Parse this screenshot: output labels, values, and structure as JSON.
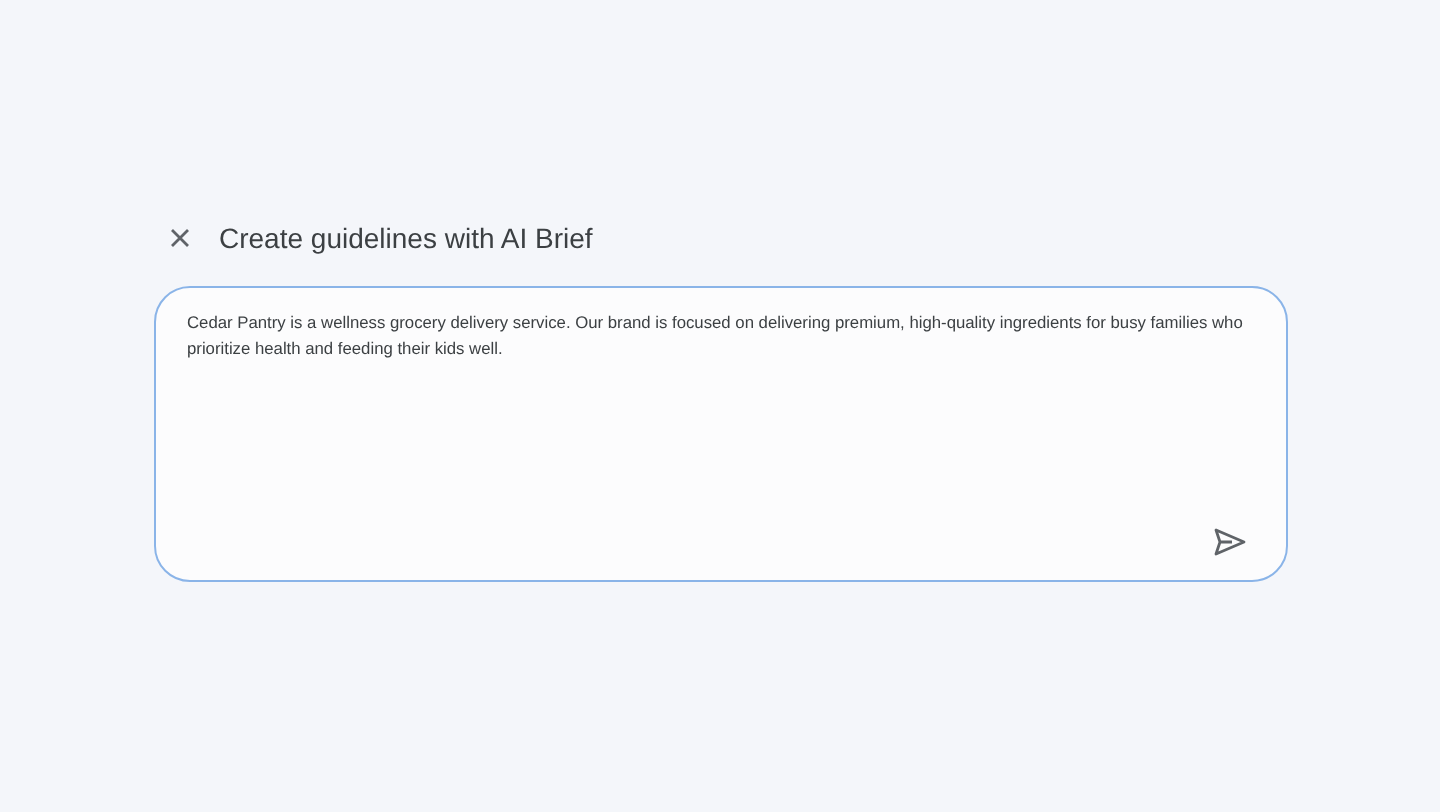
{
  "dialog": {
    "title": "Create guidelines with AI Brief"
  },
  "prompt": {
    "value": "Cedar Pantry is a wellness grocery delivery service. Our brand is focused on delivering premium, high-quality ingredients for busy families who prioritize health and feeding their kids well."
  }
}
